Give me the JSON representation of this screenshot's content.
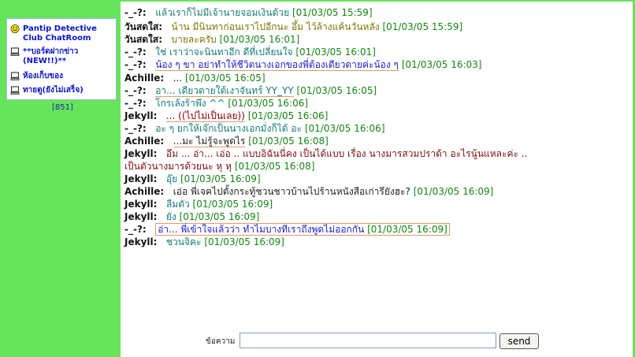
{
  "sidebar": {
    "items": [
      {
        "icon": "smiley-icon",
        "label": "Pantip Detective Club ChatRoom"
      },
      {
        "icon": "computer-icon",
        "label": "**บอร์ดฝากข่าว (NEW!!)**"
      },
      {
        "icon": "computer-icon",
        "label": "ห้องเก็บของ"
      },
      {
        "icon": "computer-icon",
        "label": "ทายตู(ยังไม่เสร็จ)"
      }
    ],
    "counter": "[851]"
  },
  "chat": [
    {
      "nick": "-_-?:",
      "text": "แล้วเราก็ไม่มีเจ้านายจอมเงินด้วย",
      "time": "[01/03/05 15:59]"
    },
    {
      "nick": "วันสดใส:",
      "text": "น้าน มีนินทาก่อนเราไปอีกนะ อึ้ม ไว้ล้างแค้นวันหลัง",
      "time": "[01/03/05 15:59]"
    },
    {
      "nick": "วันสดใส:",
      "text": "บายละครับ",
      "time": "[01/03/05 16:01]"
    },
    {
      "nick": "-_-?:",
      "text": "ใช่ เราว่าจะนินทาอีก ดีที่เปลี่ยนใจ",
      "time": "[01/03/05 16:01]"
    },
    {
      "nick": "-_-?:",
      "text": "น้อง ๆ ขา อย่าทำให้ชีวิตนางเอกของพี่ต้องเดียวดายค่ะน้อง ๆ",
      "time": "[01/03/05 16:03]"
    },
    {
      "nick": "Achille:",
      "text": "...",
      "time": "[01/03/05 16:05]"
    },
    {
      "nick": "-_-?:",
      "text": "อา... เดียวดายใต้เงาจันทร์ YY_YY",
      "time": "[01/03/05 16:05]"
    },
    {
      "nick": "-_-?:",
      "text": "โกรเล้งร้าพึง ^^",
      "time": "[01/03/05 16:06]"
    },
    {
      "nick": "Jekyll:",
      "text": "... ((ไปไม่เป็นเลย))",
      "time": "[01/03/05 16:06]"
    },
    {
      "nick": "-_-?:",
      "text": "อะ ๆ ยกให้เจ๊กเป็นนางเอกมั่งก็ได้ อะ",
      "time": "[01/03/05 16:06]"
    },
    {
      "nick": "Achille:",
      "text": "...มะ ไม่รู้จะพูดไร",
      "time": "[01/03/05 16:08]"
    },
    {
      "nick": "Jekyll:",
      "text": "อึม ... อ่า... เอ่อ .. แบบอิฉันนี่คง เป็นได้แบบ เรื่อง นางมารสวมปราด้า อะไรนู้นแหละค่ะ ..",
      "time": ""
    },
    {
      "nick": "",
      "text": "เป็นตัวนางมารด้วยนะ หุ หุ",
      "time": "[01/03/05 16:08]"
    },
    {
      "nick": "Jekyll:",
      "text": "อุ๊ย",
      "time": "[01/03/05 16:09]"
    },
    {
      "nick": "Achille:",
      "text": "เอ่อ พี่เจคไปตั้งกระทู้ชวนชาวบ้านไปร้านหนังสือเก่ารึยังฮะ?",
      "time": "[01/03/05 16:09]"
    },
    {
      "nick": "Jekyll:",
      "text": "ลืมตัว",
      "time": "[01/03/05 16:09]"
    },
    {
      "nick": "Jekyll:",
      "text": "ยัง",
      "time": "[01/03/05 16:09]"
    },
    {
      "nick": "-_-?:",
      "text": "อ่า... พี่เข้าใจแล้วว่า ทำไมบางทีเราถึงพูดไม่ออกกัน",
      "time": "[01/03/05 16:09]"
    },
    {
      "nick": "Jekyll:",
      "text": "ชวนจิคะ",
      "time": "[01/03/05 16:09]"
    }
  ],
  "form": {
    "label": "ข้อความ",
    "input_value": "",
    "send_label": "send"
  },
  "colors": {
    "sidebar_bg": "#66e45a",
    "link_blue": "#0b15c9",
    "timestamp_green": "#148614",
    "highlight_border": "#e39a6a"
  }
}
